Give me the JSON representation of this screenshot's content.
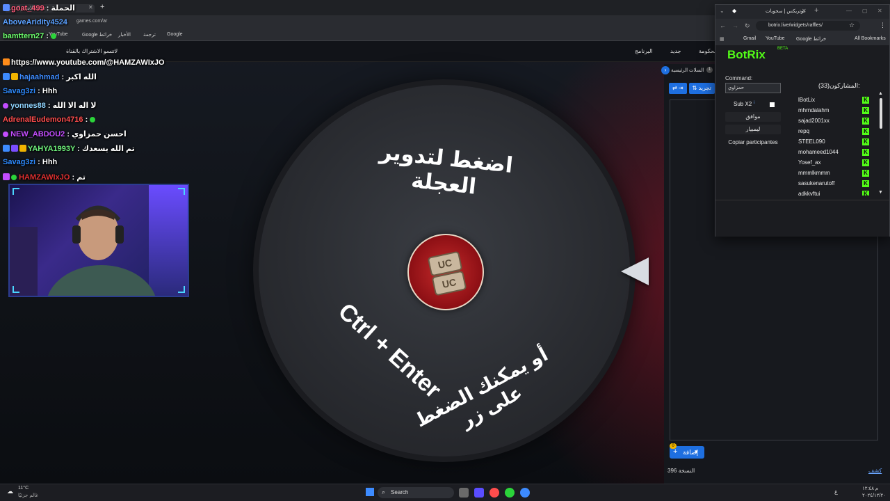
{
  "bg_browser": {
    "tab_title": "...تنبيه الاشتراك",
    "new_tab_label": "+",
    "address": "games.com/ar",
    "bookmarks": [
      "YouTube",
      "Google خرائط",
      "الأخبار",
      "ترجمة",
      "Google"
    ]
  },
  "site_nav": {
    "items": [
      "الحكومة",
      "جديد",
      "البرنامج"
    ],
    "notice": "لاتنسو الاشتراك بالقناة"
  },
  "chat": {
    "lines": [
      {
        "user": "goat_499",
        "user_color": "#ff5a7a",
        "message": ": الحملة"
      },
      {
        "user": "AboveAridity4524",
        "user_color": "#5aa0ff",
        "message": ""
      },
      {
        "user": "bamttern27",
        "user_color": "#6cff6c",
        "message": ":"
      },
      {
        "user": "",
        "user_color": "#ff5a7a",
        "message": "https://www.youtube.com/@HAMZAWIxJO"
      },
      {
        "user": "hajaahmad",
        "user_color": "#3d8bff",
        "message": ": الله اكبر"
      },
      {
        "user": "Savag3zi",
        "user_color": "#2e8bff",
        "message": ": Hhh"
      },
      {
        "user": "yonnes88",
        "user_color": "#8fd4ff",
        "message": ": لا اله الا الله"
      },
      {
        "user": "AdrenalEudemon4716",
        "user_color": "#ff4d4d",
        "message": ":"
      },
      {
        "user": "NEW_ABDOU2",
        "user_color": "#c34dff",
        "message": ": احسن حمزاوي"
      },
      {
        "user": "YAHYA1993Y",
        "user_color": "#6ef07c",
        "message": ": تم الله يسعدك"
      },
      {
        "user": "Savag3zi",
        "user_color": "#2e8bff",
        "message": ": Hhh"
      },
      {
        "user": "HAMZAWIxJO",
        "user_color": "#e03030",
        "message": ": تم"
      }
    ]
  },
  "wheel": {
    "top_text": "اضغط لتدوير العجلة",
    "bottom_text_1": "أو يمكنك الضغط على زر",
    "bottom_text_2": "Ctrl + Enter",
    "accent": "#8c0f14"
  },
  "side_panel": {
    "tab_label": "السلات الرئيسية",
    "tab_count": "1",
    "sort_label": "تجريد",
    "add_label": "إضافة",
    "add_badge": "0",
    "count_label": "النسخة 396",
    "help_link": "كشف"
  },
  "popup": {
    "tab_title": "بوتريكس | سحوبات",
    "url": "botrix.live/widgets/raffles/",
    "bookmarks": [
      "Gmail",
      "YouTube",
      "Google خرائط"
    ],
    "all_bookmarks": "All Bookmarks",
    "brand": "BotRix",
    "beta": "BETA",
    "command_label": "Command:",
    "command_value": "حمزاوي",
    "sub_label": "Sub X2",
    "sub_info": "i",
    "approve_label": "موافق",
    "reset_label": "ليمبيار",
    "copy_label": "Copiar participantes",
    "participants_header": "المشاركون(33):",
    "participants": [
      "lBotLix",
      "mhrndalahm",
      "sajad2001xx",
      "repq",
      "STEEL090",
      "mohameed1044",
      "Yosef_ax",
      "mmmlkmmm",
      "sasukenarutoff",
      "adkkvftui"
    ],
    "kick_color": "#53fc18"
  },
  "taskbar": {
    "weather_temp": "11°C",
    "weather_desc": "غالم جزئيًا",
    "search": "Search",
    "lang": "ع",
    "time": "م ١٢:٤٨",
    "date": "٢٠٢٤/١٢/٢٠"
  }
}
